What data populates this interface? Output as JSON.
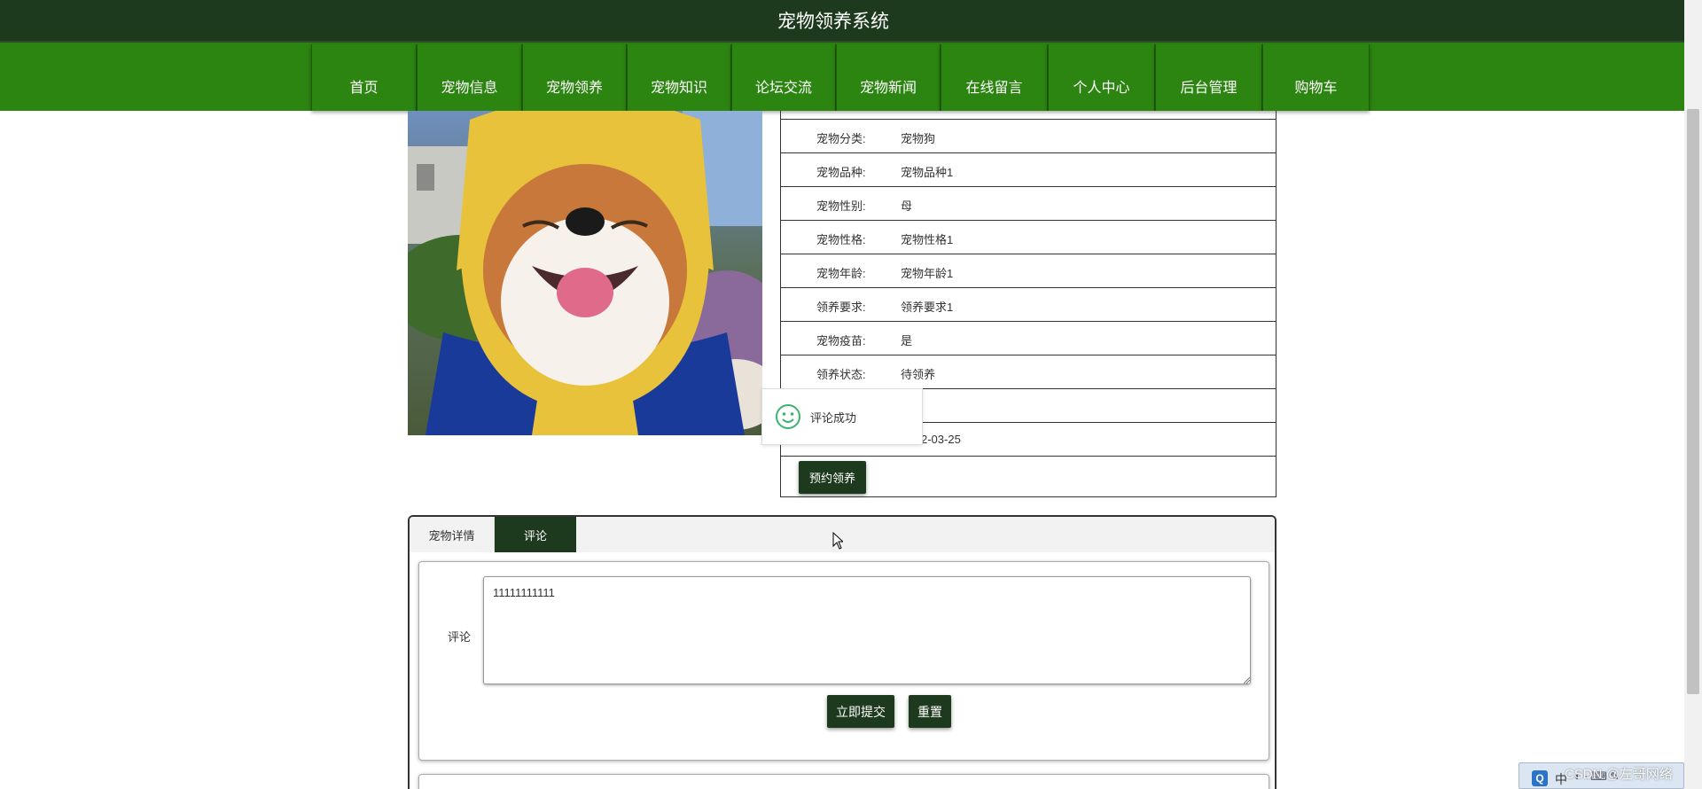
{
  "site": {
    "title": "宠物领养系统"
  },
  "nav": {
    "items": [
      {
        "label": "首页"
      },
      {
        "label": "宠物信息"
      },
      {
        "label": "宠物领养"
      },
      {
        "label": "宠物知识"
      },
      {
        "label": "论坛交流"
      },
      {
        "label": "宠物新闻"
      },
      {
        "label": "在线留言"
      },
      {
        "label": "个人中心"
      },
      {
        "label": "后台管理"
      },
      {
        "label": "购物车"
      }
    ]
  },
  "pet": {
    "image_alt": "shiba-inu-dog-photo",
    "fields": [
      {
        "label": "宠物分类:",
        "value": "宠物狗"
      },
      {
        "label": "宠物品种:",
        "value": "宠物品种1"
      },
      {
        "label": "宠物性别:",
        "value": "母"
      },
      {
        "label": "宠物性格:",
        "value": "宠物性格1"
      },
      {
        "label": "宠物年龄:",
        "value": "宠物年龄1"
      },
      {
        "label": "领养要求:",
        "value": "领养要求1"
      },
      {
        "label": "宠物疫苗:",
        "value": "是"
      },
      {
        "label": "领养状态:",
        "value": "待领养"
      },
      {
        "label": "",
        "value": ""
      },
      {
        "label": "",
        "value": "2-03-25"
      }
    ],
    "adopt_button": "预约领养"
  },
  "toast": {
    "message": "评论成功",
    "icon": "smile-icon"
  },
  "tabs": [
    {
      "label": "宠物详情",
      "active": false
    },
    {
      "label": "评论",
      "active": true
    }
  ],
  "comment_form": {
    "label": "评论",
    "value": "11111111111",
    "submit_label": "立即提交",
    "reset_label": "重置"
  },
  "ime": {
    "icon_label": "Q",
    "lang": "中",
    "watermark": "CSDN @左哥网络"
  },
  "colors": {
    "dark_green": "#1e3a1e",
    "nav_green": "#2c8411",
    "toast_green": "#3cb371"
  }
}
